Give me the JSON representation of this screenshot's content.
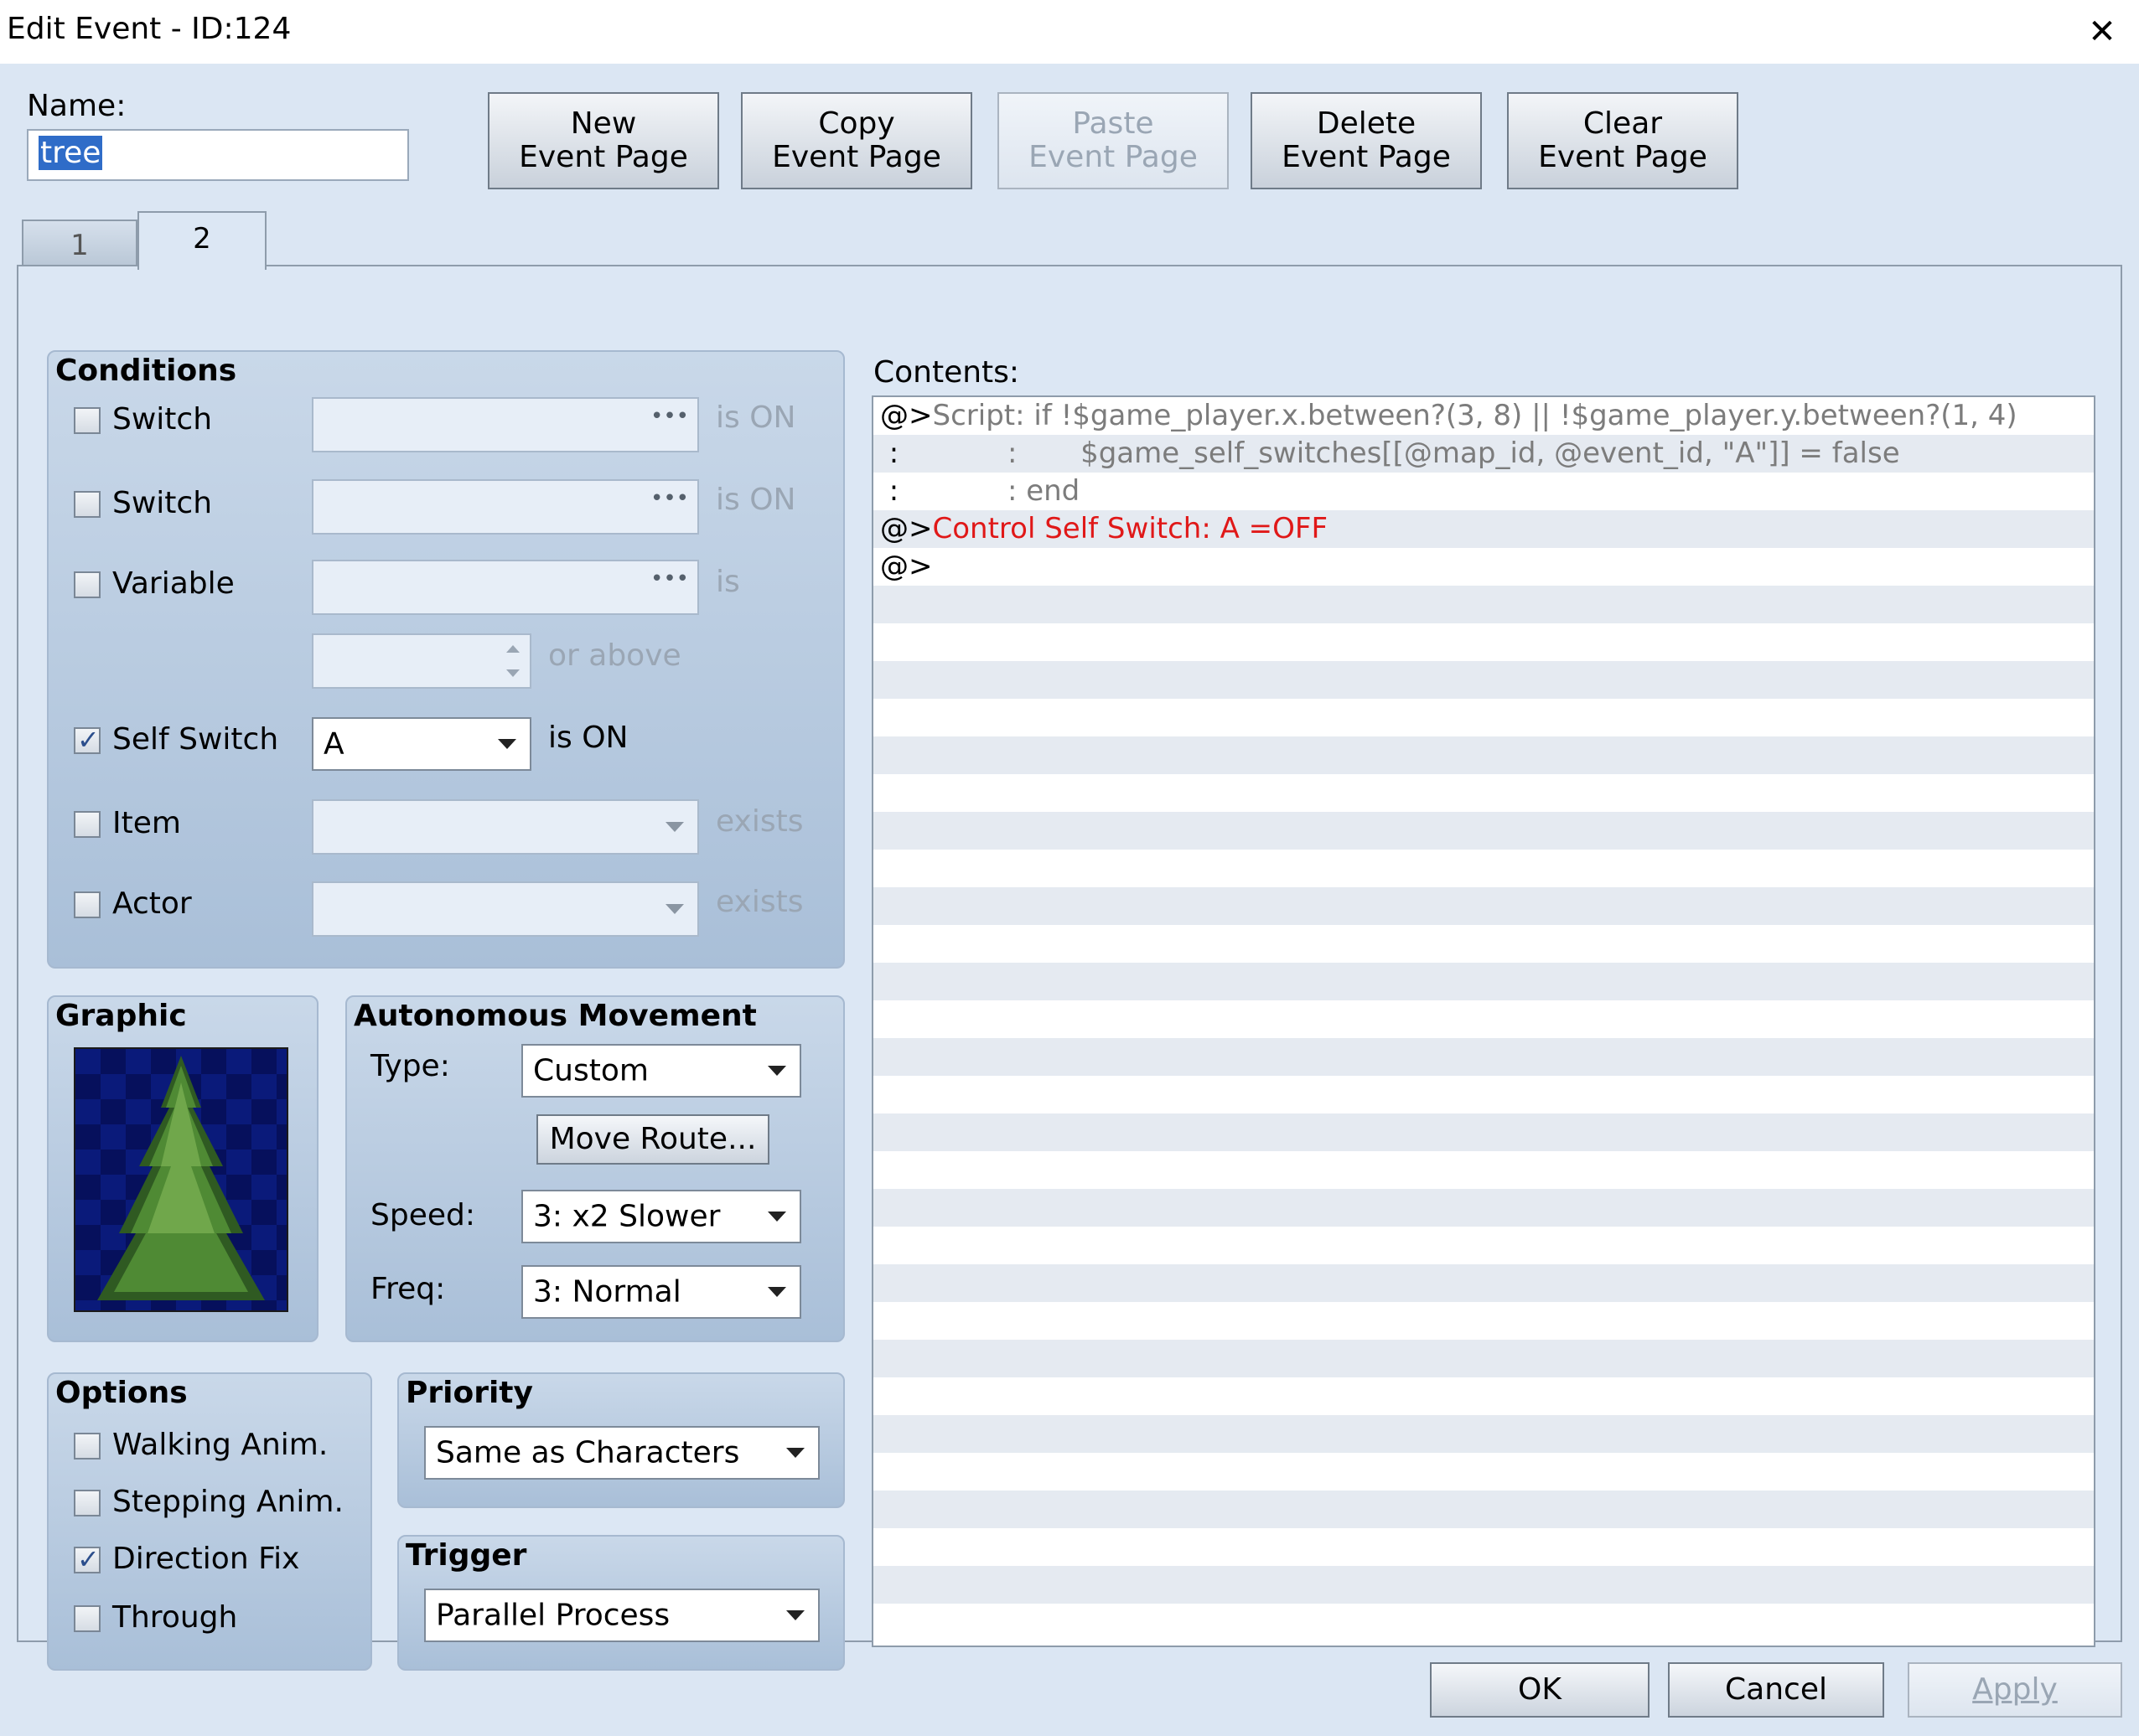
{
  "window": {
    "title": "Edit Event - ID:124"
  },
  "name": {
    "label": "Name:",
    "value": "tree"
  },
  "toolbar": {
    "new_page": [
      "New",
      "Event Page"
    ],
    "copy_page": [
      "Copy",
      "Event Page"
    ],
    "paste_page": [
      "Paste",
      "Event Page"
    ],
    "delete_page": [
      "Delete",
      "Event Page"
    ],
    "clear_page": [
      "Clear",
      "Event Page"
    ]
  },
  "tabs": [
    "1",
    "2"
  ],
  "conditions": {
    "title": "Conditions",
    "switch1": {
      "label": "Switch",
      "suffix": "is ON",
      "checked": false
    },
    "switch2": {
      "label": "Switch",
      "suffix": "is ON",
      "checked": false
    },
    "variable": {
      "label": "Variable",
      "suffix": "is",
      "suffix2": "or above",
      "checked": false
    },
    "self_switch": {
      "label": "Self Switch",
      "value": "A",
      "suffix": "is ON",
      "checked": true
    },
    "item": {
      "label": "Item",
      "suffix": "exists",
      "checked": false
    },
    "actor": {
      "label": "Actor",
      "suffix": "exists",
      "checked": false
    }
  },
  "graphic": {
    "title": "Graphic"
  },
  "movement": {
    "title": "Autonomous Movement",
    "type_label": "Type:",
    "type_value": "Custom",
    "move_route": "Move Route...",
    "speed_label": "Speed:",
    "speed_value": "3: x2 Slower",
    "freq_label": "Freq:",
    "freq_value": "3: Normal"
  },
  "options": {
    "title": "Options",
    "walking": {
      "label": "Walking Anim.",
      "checked": false
    },
    "stepping": {
      "label": "Stepping Anim.",
      "checked": false
    },
    "direction_fix": {
      "label": "Direction Fix",
      "checked": true
    },
    "through": {
      "label": "Through",
      "checked": false
    }
  },
  "priority": {
    "title": "Priority",
    "value": "Same as Characters"
  },
  "trigger": {
    "title": "Trigger",
    "value": "Parallel Process"
  },
  "contents": {
    "label": "Contents:",
    "lines": [
      {
        "prefix": "@>",
        "text": "Script: if !$game_player.x.between?(3, 8) || !$game_player.y.between?(1, 4)",
        "color": "gray"
      },
      {
        "prefix": " :",
        "text": "            :       $game_self_switches[[@map_id, @event_id, \"A\"]] = false",
        "color": "gray"
      },
      {
        "prefix": " :",
        "text": "            : end",
        "color": "gray"
      },
      {
        "prefix": "@>",
        "text": "Control Self Switch: A =OFF",
        "color": "red"
      },
      {
        "prefix": "@>",
        "text": "",
        "color": "gray"
      }
    ]
  },
  "footer": {
    "ok": "OK",
    "cancel": "Cancel",
    "apply": "Apply"
  }
}
